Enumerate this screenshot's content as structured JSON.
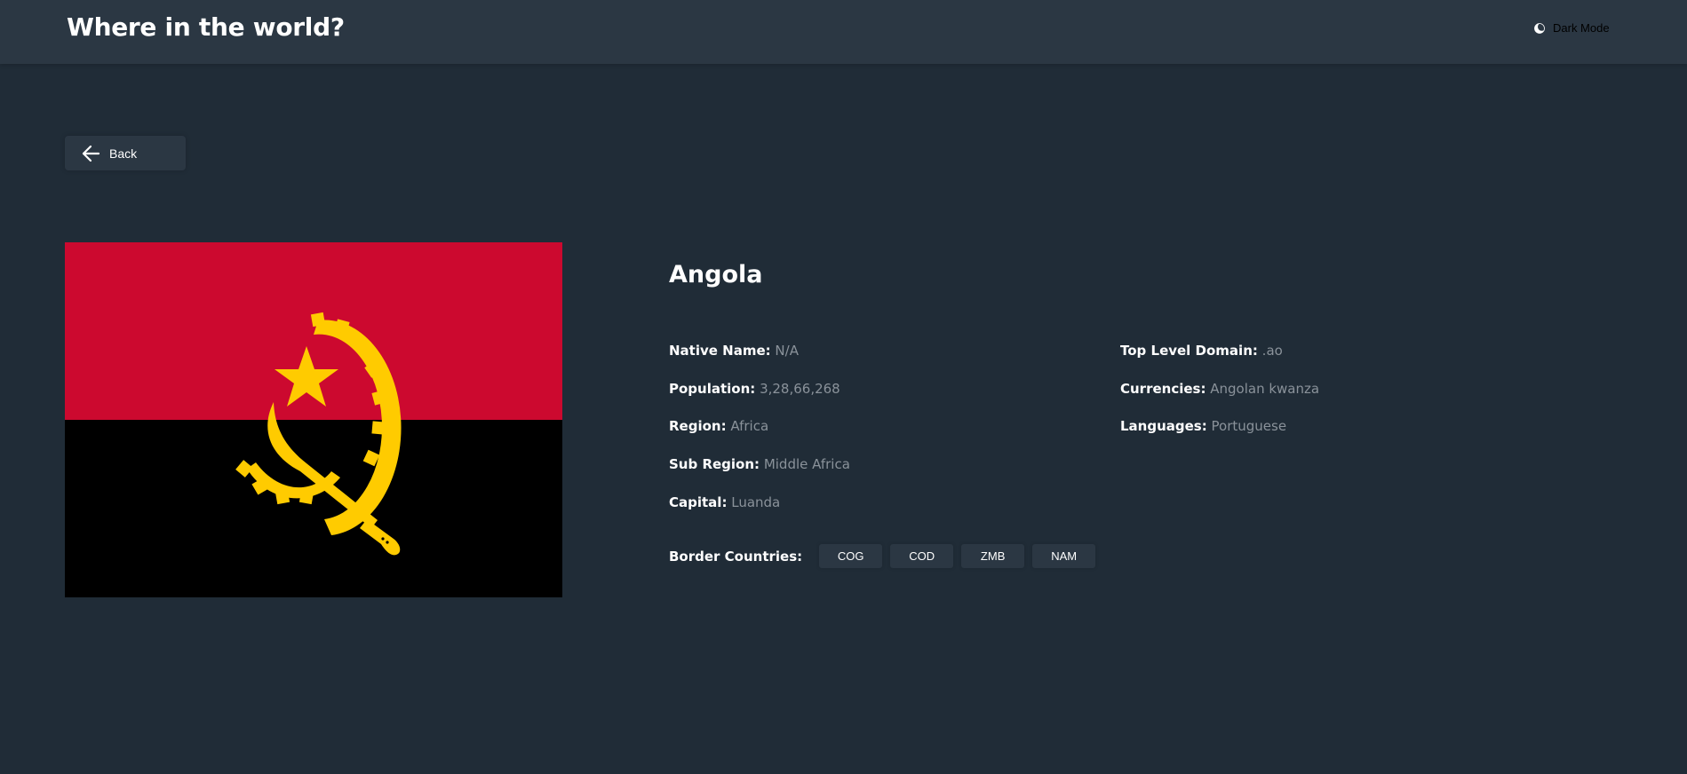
{
  "header": {
    "title": "Where in the world?",
    "mode_label": "Dark Mode",
    "mode_icon": "moon-icon"
  },
  "back_button": {
    "label": "Back",
    "icon": "arrow-left-icon"
  },
  "country": {
    "name": "Angola",
    "flag_colors": {
      "top": "#cc092f",
      "bottom": "#000000",
      "emblem": "#ffcb00"
    },
    "details_left": [
      {
        "label": "Native Name:",
        "value": "N/A"
      },
      {
        "label": "Population:",
        "value": "3,28,66,268"
      },
      {
        "label": "Region:",
        "value": "Africa"
      },
      {
        "label": "Sub Region:",
        "value": "Middle Africa"
      },
      {
        "label": "Capital:",
        "value": "Luanda"
      }
    ],
    "details_right": [
      {
        "label": "Top Level Domain:",
        "value": ".ao"
      },
      {
        "label": "Currencies:",
        "value": "Angolan kwanza"
      },
      {
        "label": "Languages:",
        "value": "Portuguese"
      }
    ],
    "border_label": "Border Countries:",
    "border_countries": [
      "COG",
      "COD",
      "ZMB",
      "NAM"
    ]
  }
}
